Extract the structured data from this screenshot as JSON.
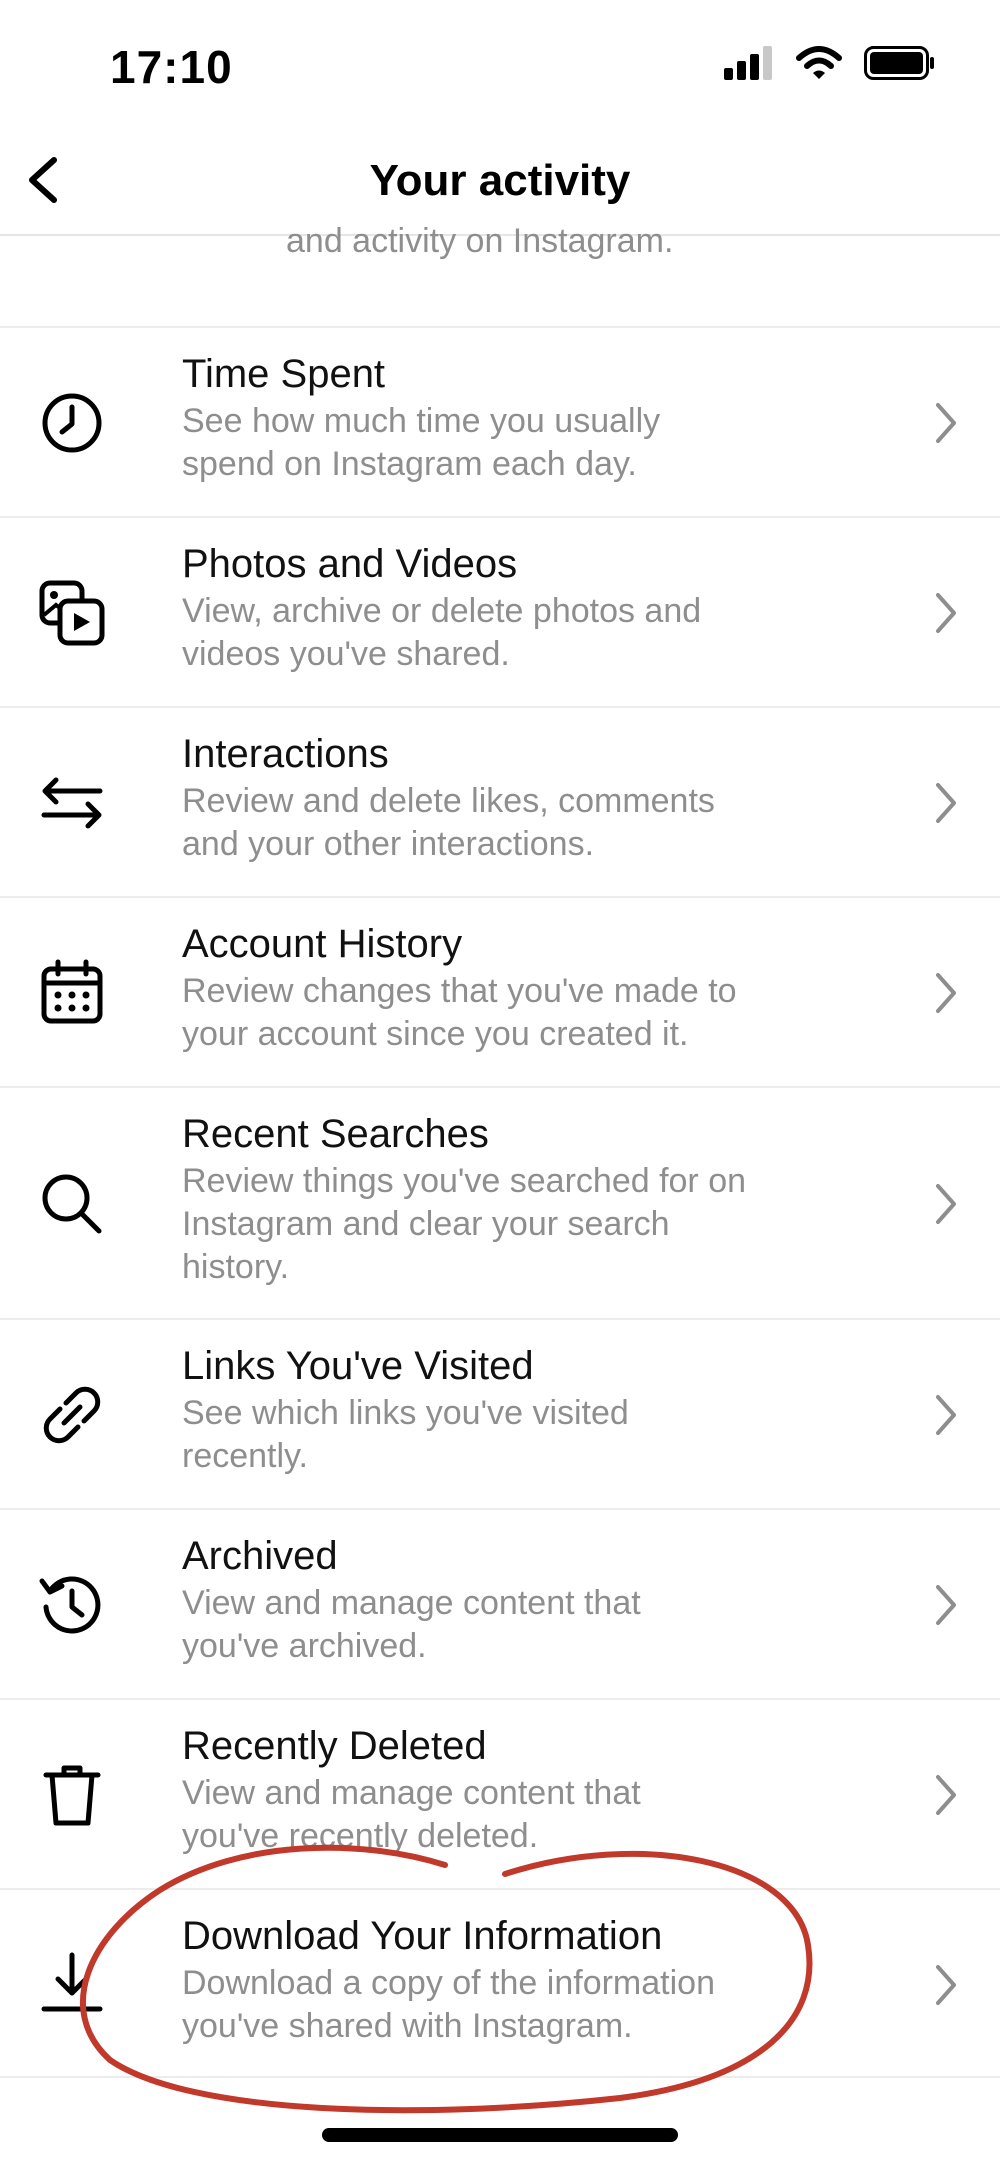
{
  "status_bar": {
    "time": "17:10"
  },
  "header": {
    "title": "Your activity",
    "back_icon": "chevron-left-icon"
  },
  "clipped_text": "and activity on Instagram.",
  "items": [
    {
      "id": "time-spent",
      "icon": "clock-icon",
      "title": "Time Spent",
      "desc": [
        "See how much time you usually",
        "spend on Instagram each day."
      ]
    },
    {
      "id": "photos-and-videos",
      "icon": "photos-videos-icon",
      "title": "Photos and Videos",
      "desc": [
        "View, archive or delete photos and",
        "videos you've shared."
      ]
    },
    {
      "id": "interactions",
      "icon": "arrows-swap-icon",
      "title": "Interactions",
      "desc": [
        "Review and delete likes, comments",
        "and your other interactions."
      ]
    },
    {
      "id": "account-history",
      "icon": "calendar-icon",
      "title": "Account History",
      "desc": [
        "Review changes that you've made to",
        "your account since you created it."
      ]
    },
    {
      "id": "recent-searches",
      "icon": "search-icon",
      "title": "Recent Searches",
      "desc": [
        "Review things you've searched for on",
        "Instagram and clear your search",
        "history."
      ]
    },
    {
      "id": "links-visited",
      "icon": "link-icon",
      "title": "Links You've Visited",
      "desc": [
        "See which links you've visited",
        "recently."
      ]
    },
    {
      "id": "archived",
      "icon": "history-icon",
      "title": "Archived",
      "desc": [
        "View and manage content that",
        "you've archived."
      ]
    },
    {
      "id": "recently-deleted",
      "icon": "trash-icon",
      "title": "Recently Deleted",
      "desc": [
        "View and manage content that",
        "you've recently deleted."
      ]
    },
    {
      "id": "download-information",
      "icon": "download-icon",
      "title": "Download Your Information",
      "desc": [
        "Download a copy of the information",
        "you've shared with Instagram."
      ]
    }
  ],
  "colors": {
    "annotation": "#c0392b",
    "secondary_text": "#8e8e8e",
    "divider": "#ececec"
  }
}
